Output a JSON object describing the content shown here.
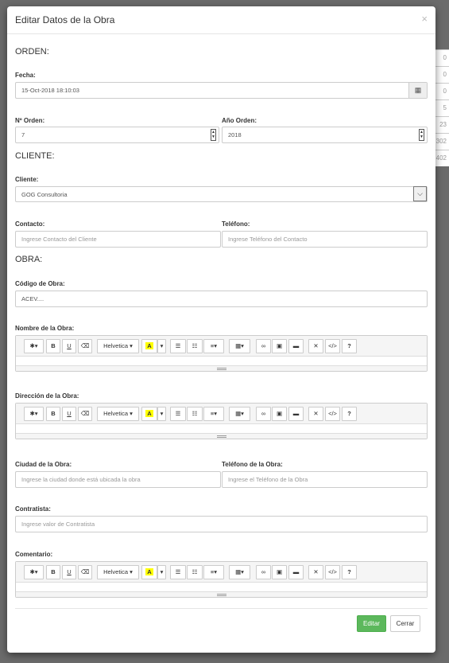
{
  "background_rows": [
    "0",
    "0",
    "0",
    "5",
    "23",
    "302",
    "402"
  ],
  "dialog": {
    "title": "Editar Datos de la Obra",
    "close": "×"
  },
  "sections": {
    "orden": "ORDEN:",
    "cliente": "CLIENTE:",
    "obra": "OBRA:"
  },
  "fields": {
    "fecha": {
      "label": "Fecha:",
      "value": "15-Oct-2018 18:10:03"
    },
    "numero_orden": {
      "label": "Nº Orden:",
      "value": "7"
    },
    "anio_orden": {
      "label": "Año Orden:",
      "value": "2018"
    },
    "cliente": {
      "label": "Cliente:",
      "value": "GOG Consultoria"
    },
    "contacto": {
      "label": "Contacto:",
      "placeholder": "Ingrese Contacto del Cliente"
    },
    "telefono": {
      "label": "Teléfono:",
      "placeholder": "Ingrese Teléfono del Contacto"
    },
    "codigo_obra": {
      "label": "Código de Obra:",
      "value": "ACEV...."
    },
    "nombre_obra": {
      "label": "Nombre de la Obra:"
    },
    "direccion_obra": {
      "label": "Dirección de la Obra:"
    },
    "ciudad_obra": {
      "label": "Ciudad de la Obra:",
      "placeholder": "Ingrese la ciudad donde está ubicada la obra"
    },
    "telefono_obra": {
      "label": "Teléfono de la Obra:",
      "placeholder": "Ingrese el Teléfono de la Obra"
    },
    "contratista": {
      "label": "Contratista:",
      "placeholder": "Ingrese valor de Contratista"
    },
    "comentario": {
      "label": "Comentario:"
    }
  },
  "toolbar": {
    "font_name": "Helvetica",
    "bold": "B",
    "underline": "U",
    "help": "?",
    "highlight_color": "#ffff00"
  },
  "buttons": {
    "edit": "Editar",
    "close": "Cerrar"
  }
}
